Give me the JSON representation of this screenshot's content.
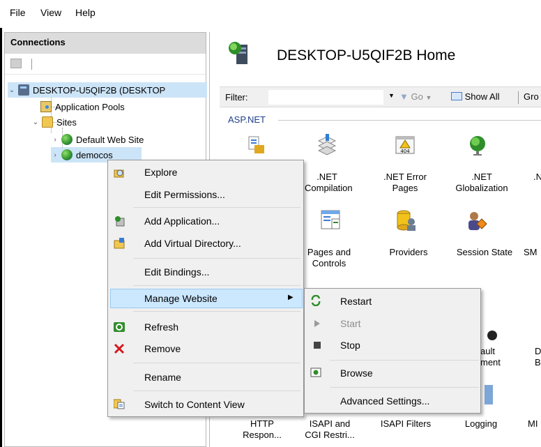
{
  "menubar": {
    "file": "File",
    "view": "View",
    "help": "Help"
  },
  "connections": {
    "title": "Connections",
    "tree": {
      "server": "DESKTOP-U5QIF2B (DESKTOP",
      "app_pools": "Application Pools",
      "sites": "Sites",
      "default_site": "Default Web Site",
      "demo_site": "democos"
    }
  },
  "main": {
    "title": "DESKTOP-U5QIF2B Home",
    "filter_label": "Filter:",
    "go_label": "Go",
    "show_all_label": "Show All",
    "group_label": "Gro",
    "section_aspnet": "ASP.NET",
    "features": {
      "net_compilation": ".NET\nCompilation",
      "net_error_pages": ".NET Error\nPages",
      "net_globalization": ".NET\nGlobalization",
      "net_partial": ".N",
      "error_icon_label": "404",
      "pages_controls": "Pages and\nControls",
      "providers": "Providers",
      "session_state": "Session State",
      "sm_partial": "SM",
      "default_doc_partial": "ault\nment",
      "dir_browsing_partial": "D\nB",
      "http_response": "HTTP\nRespon...",
      "isapi_cgi": "ISAPI and\nCGI Restri...",
      "isapi_filters": "ISAPI Filters",
      "logging": "Logging",
      "mi_partial": "MI"
    }
  },
  "context_menu": {
    "explore": "Explore",
    "edit_permissions": "Edit Permissions...",
    "add_application": "Add Application...",
    "add_virtual_directory": "Add Virtual Directory...",
    "edit_bindings": "Edit Bindings...",
    "manage_website": "Manage Website",
    "refresh": "Refresh",
    "remove": "Remove",
    "rename": "Rename",
    "switch_content_view": "Switch to Content View"
  },
  "submenu": {
    "restart": "Restart",
    "start": "Start",
    "stop": "Stop",
    "browse": "Browse",
    "advanced_settings": "Advanced Settings..."
  },
  "colors": {
    "selection": "#cce4f7",
    "menu_highlight": "#cce8ff",
    "section_text": "#1e3f8a"
  }
}
